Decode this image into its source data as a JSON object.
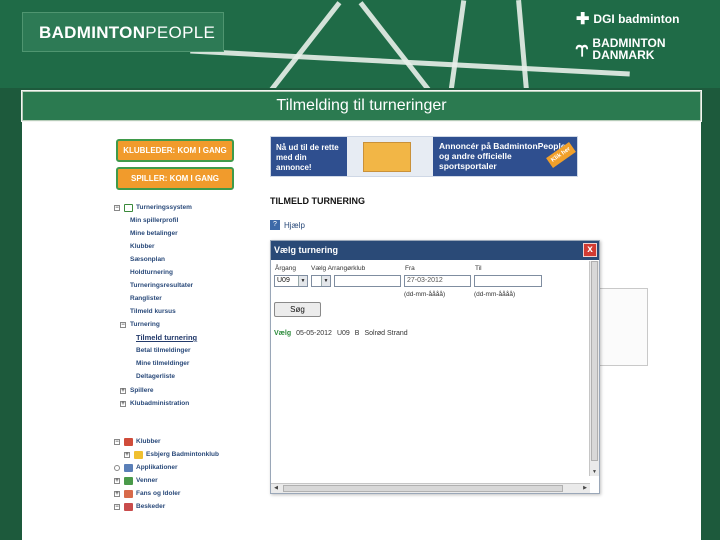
{
  "header": {
    "logo_bold": "BADMINTON",
    "logo_light": "PEOPLE",
    "dgi": "DGI badminton",
    "bd_line1": "BADMINTON",
    "bd_line2": "DANMARK"
  },
  "title": "Tilmelding til turneringer",
  "buttons": {
    "club_leader": "KLUBLEDER: KOM I GANG",
    "player": "SPILLER: KOM I GANG"
  },
  "tree": {
    "items": [
      "Turneringssystem",
      "Min spillerprofil",
      "Mine betalinger",
      "Klubber",
      "Sæsonplan",
      "Holdturnering",
      "Turneringsresultater",
      "Ranglister",
      "Tilmeld kursus",
      "Turnering",
      "Tilmeld turnering",
      "Betal tilmeldinger",
      "Mine tilmeldinger",
      "Deltagerliste",
      "Spillere",
      "Klubadministration"
    ],
    "items2": [
      "Klubber",
      "Esbjerg Badmintonklub",
      "Applikationer",
      "Venner",
      "Fans og Idoler",
      "Beskeder"
    ]
  },
  "banner": {
    "left": "Nå ud til de rette med din annonce!",
    "right": "Annoncér på BadmintonPeople og andre officielle sportsportaler",
    "ribbon": "Klik her"
  },
  "heading": "TILMELD TURNERING",
  "help": "Hjælp",
  "dialog": {
    "title": "Vælg turnering",
    "close": "x",
    "labels": {
      "aargang": "Årgang",
      "arrangor": "Vælg Arrangørklub",
      "fra": "Fra",
      "til": "Til"
    },
    "aargang_value": "U09",
    "fra_value": "27-03-2012",
    "date_hint": "(dd-mm-åååå)",
    "search": "Søg",
    "result": {
      "action": "Vælg",
      "date": "05-05-2012",
      "class": "U09",
      "level": "B",
      "club": "Solrød Strand"
    }
  },
  "colors": {
    "green": "#1f6b47",
    "title_bar": "#2b7a50",
    "orange": "#f19b2c",
    "dialog_title": "#2a4a77",
    "close": "#d23b33"
  }
}
